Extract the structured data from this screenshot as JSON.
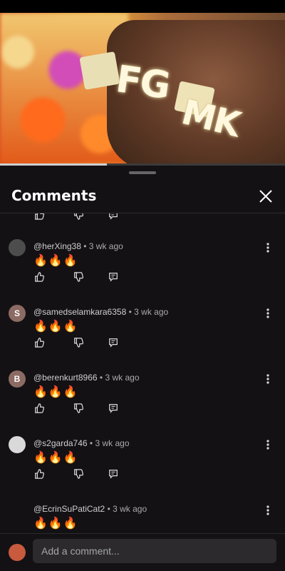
{
  "video": {
    "ring_text_left": "FG",
    "ring_text_right": "MK",
    "progress_fraction": 0.375
  },
  "sheet": {
    "title": "Comments",
    "close_icon": "close-icon"
  },
  "comments": [
    {
      "author": "@herXing38",
      "time": "3 wk ago",
      "text": "🔥🔥🔥",
      "avatar_letter": "",
      "avatar_color": "#4d4d4d"
    },
    {
      "author": "@samedselamkara6358",
      "time": "3 wk ago",
      "text": "🔥🔥🔥",
      "avatar_letter": "S",
      "avatar_color": "#8b6b63"
    },
    {
      "author": "@berenkurt8966",
      "time": "3 wk ago",
      "text": "🔥🔥🔥",
      "avatar_letter": "B",
      "avatar_color": "#8b6b63"
    },
    {
      "author": "@s2garda746",
      "time": "3 wk ago",
      "text": "🔥🔥🔥",
      "avatar_letter": "",
      "avatar_color": "#d9d9d9"
    },
    {
      "author": "@EcrinSuPatiCat2",
      "time": "3 wk ago",
      "text": "🔥🔥🔥",
      "avatar_letter": "",
      "avatar_color": "#141114"
    }
  ],
  "composer": {
    "placeholder": "Add a comment..."
  },
  "icons": {
    "like": "thumbs-up-icon",
    "dislike": "thumbs-down-icon",
    "reply": "reply-icon",
    "more": "more-vertical-icon"
  }
}
